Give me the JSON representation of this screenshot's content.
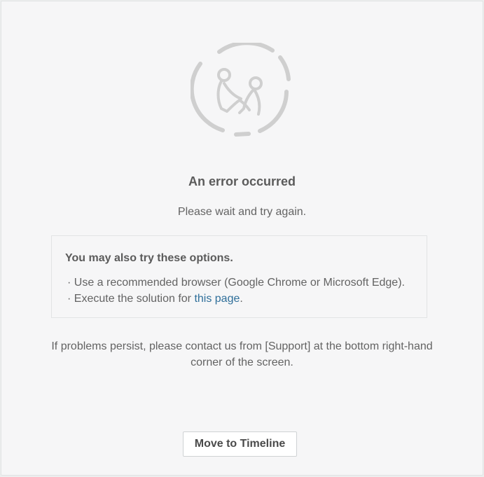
{
  "error": {
    "title": "An error occurred",
    "subtitle": "Please wait and try again."
  },
  "options": {
    "heading": "You may also try these options.",
    "bullet": "·",
    "item1": "Use a recommended browser (Google Chrome or Microsoft Edge).",
    "item2_prefix": "Execute the solution for ",
    "item2_link": "this page",
    "item2_suffix": "."
  },
  "support_message": "If problems persist, please contact us from [Support] at the bottom right-hand corner of the screen.",
  "actions": {
    "move_to_timeline": "Move to Timeline"
  },
  "colors": {
    "background": "#f6f6f7",
    "text": "#636363",
    "link": "#2f6f9a",
    "illustration": "#cfcfcf"
  },
  "icons": {
    "illustration": "broken-connection-people-icon"
  }
}
